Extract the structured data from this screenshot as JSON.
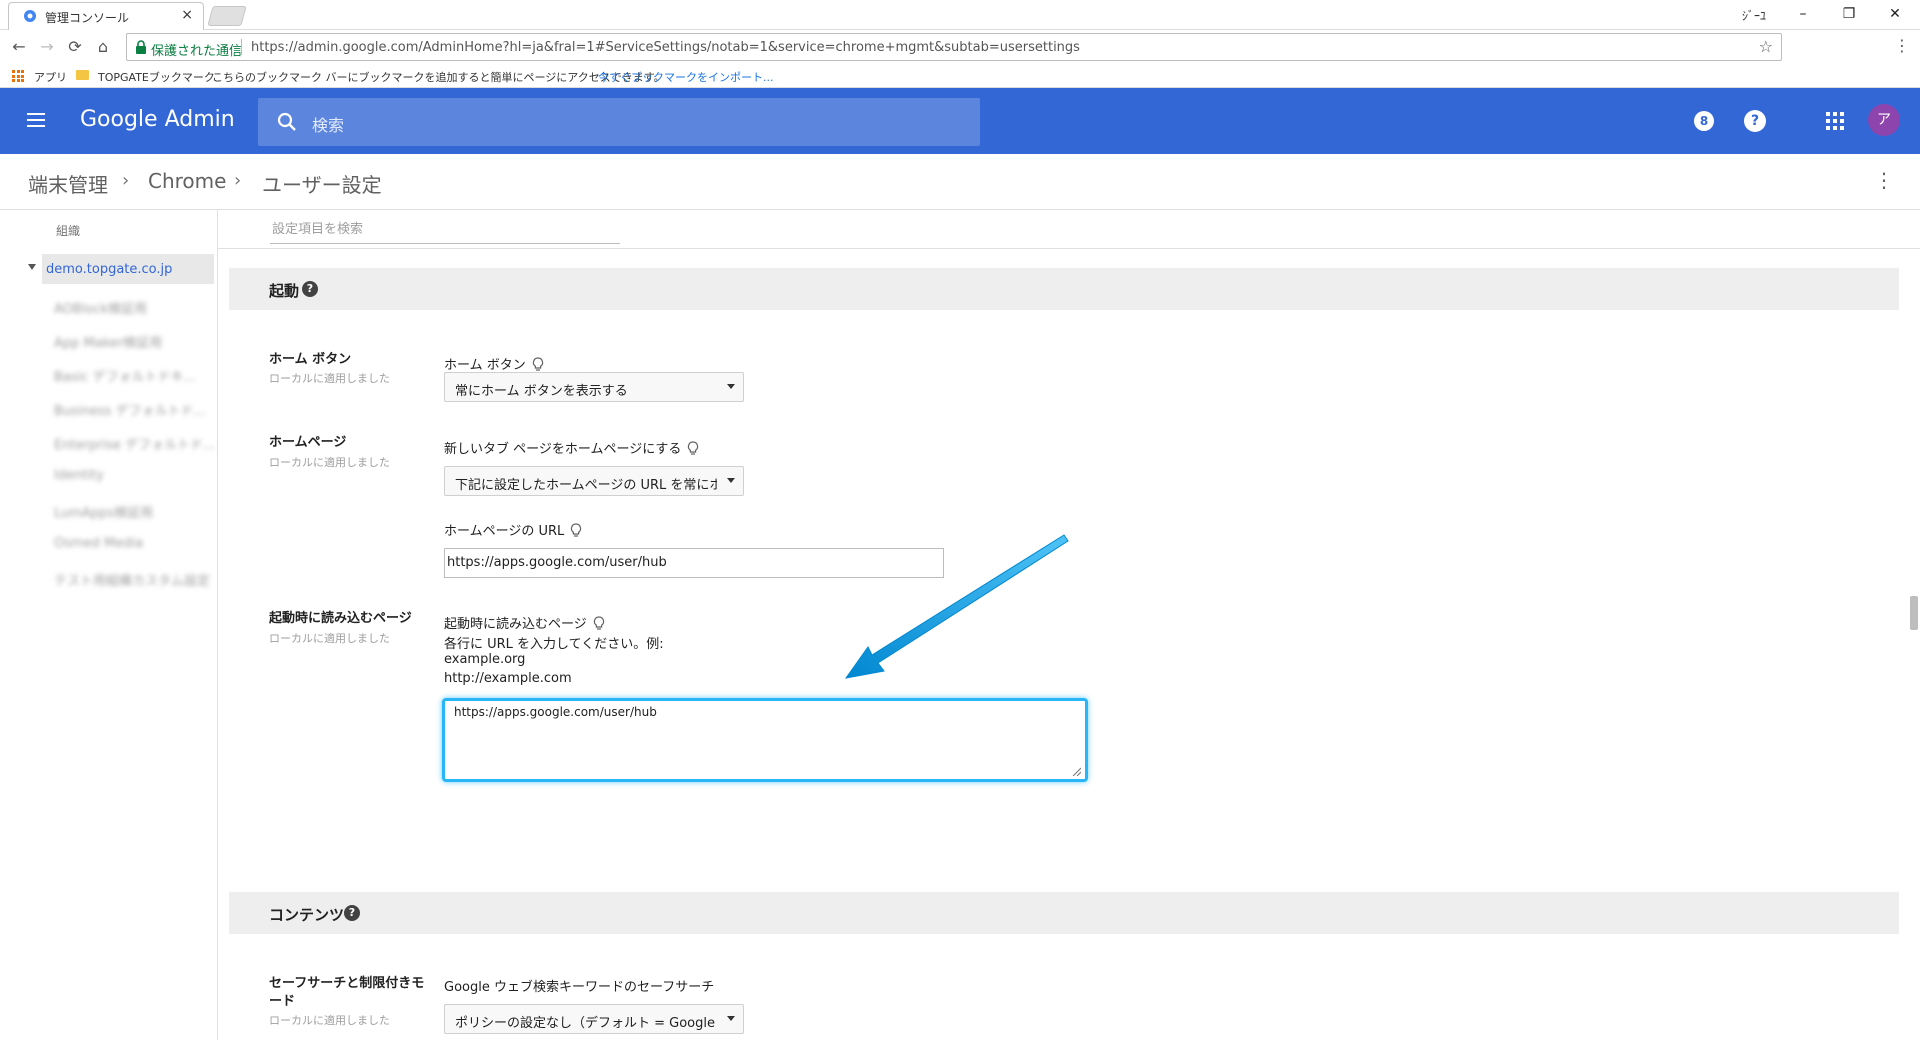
{
  "browser": {
    "tab_title": "管理コンソール",
    "tab_close": "×",
    "user_label": "ｼﾞｰﾕ",
    "window_controls": [
      "–",
      "❐",
      "✕"
    ],
    "nav": {
      "back": "←",
      "forward": "→",
      "reload": "⟳",
      "home": "⌂"
    },
    "secure_label": "保護された通信",
    "url": "https://admin.google.com/AdminHome?hl=ja&fral=1#ServiceSettings/notab=1&service=chrome+mgmt&subtab=usersettings",
    "star": "☆",
    "menu": "⋮",
    "bookmarks": {
      "apps": "アプリ",
      "folder": "TOPGATEブックマーク",
      "hint": "こちらのブックマーク バーにブックマークを追加すると簡単にページにアクセスできます。",
      "import_link": "今すぐブックマークをインポート..."
    }
  },
  "header": {
    "brand": "Google Admin",
    "search_placeholder": "検索",
    "avatar_initial": "ア",
    "support_icon": "8",
    "help_icon": "?",
    "accent_color": "#3367d6"
  },
  "breadcrumb": {
    "items": [
      "端末管理",
      "Chrome",
      "ユーザー設定"
    ],
    "separator": "›",
    "more": "⋮"
  },
  "sidebar": {
    "header": "組織",
    "root": "demo.topgate.co.jp",
    "children": [
      "AOBlock検証用",
      "App Maker検証用",
      "Basic デフォルトドキ...",
      "Business デフォルトド...",
      "Enterprise デフォルトド...",
      "Identity",
      "LumApps検証用",
      "Osmed Media",
      "テスト用組織カスタム設定"
    ]
  },
  "main": {
    "filter_placeholder": "設定項目を検索",
    "sections": {
      "startup": {
        "title": "起動",
        "help": "?",
        "settings": {
          "home_button": {
            "title": "ホーム ボタン",
            "sub": "ローカルに適用しました",
            "label": "ホーム ボタン",
            "value": "常にホーム ボタンを表示する"
          },
          "homepage": {
            "title": "ホームページ",
            "sub": "ローカルに適用しました",
            "label": "新しいタブ ページをホームページにする",
            "value": "下記に設定したホームページの URL を常にホ",
            "url_label": "ホームページの URL",
            "url_value": "https://apps.google.com/user/hub"
          },
          "startup_pages": {
            "title": "起動時に読み込むページ",
            "sub": "ローカルに適用しました",
            "label": "起動時に読み込むページ",
            "instruction": "各行に URL を入力してください。例:",
            "example1": "example.org",
            "example2": "http://example.com",
            "textarea_value": "https://apps.google.com/user/hub"
          }
        }
      },
      "content": {
        "title": "コンテンツ",
        "help": "?",
        "settings": {
          "safesearch": {
            "title_line1": "セーフサーチと制限付きモ",
            "title_line2": "ード",
            "sub": "ローカルに適用しました",
            "label": "Google ウェブ検索キーワードのセーフサーチ",
            "value": "ポリシーの設定なし（デフォルト = Google ウ"
          }
        }
      }
    }
  },
  "annotation": {
    "arrow_color": "#29b6f6"
  }
}
